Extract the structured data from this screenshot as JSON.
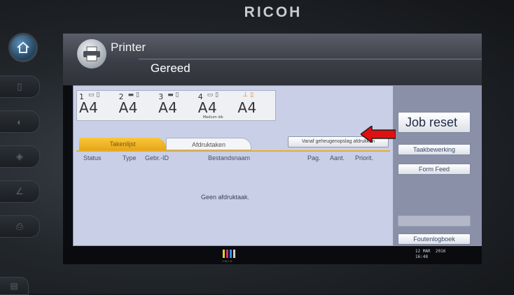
{
  "brand": "RICOH",
  "header": {
    "app_title": "Printer",
    "status": "Gereed"
  },
  "trays": [
    {
      "num": "1",
      "paper": "A4",
      "note": ""
    },
    {
      "num": "2",
      "paper": "A4",
      "note": ""
    },
    {
      "num": "3",
      "paper": "A4",
      "note": ""
    },
    {
      "num": "4",
      "paper": "A4",
      "note": "Medium dik"
    },
    {
      "num": "",
      "paper": "A4",
      "note": ""
    }
  ],
  "tabs": {
    "active": "Takenlijst",
    "inactive": "Afdruktaken"
  },
  "memory_button": "Vanaf geheugenopslag afdrukken",
  "columns": [
    "Status",
    "Type",
    "Gebr.-ID",
    "Bestandsnaam",
    "Pag.",
    "Aant.",
    "Priorit."
  ],
  "empty_message": "Geen afdruktaak.",
  "right_buttons": {
    "job_reset": "Job reset",
    "job_edit": "Taakbewerking",
    "form_feed": "Form Feed",
    "error_log": "Foutenlogboek"
  },
  "ink_label": "YMCK",
  "clock": {
    "date": "12 MAR  2016",
    "time": "16:48"
  },
  "colors": {
    "tab_active": "#f0b42a",
    "panel": "#c8cfe6",
    "arrow": "#e01010"
  }
}
